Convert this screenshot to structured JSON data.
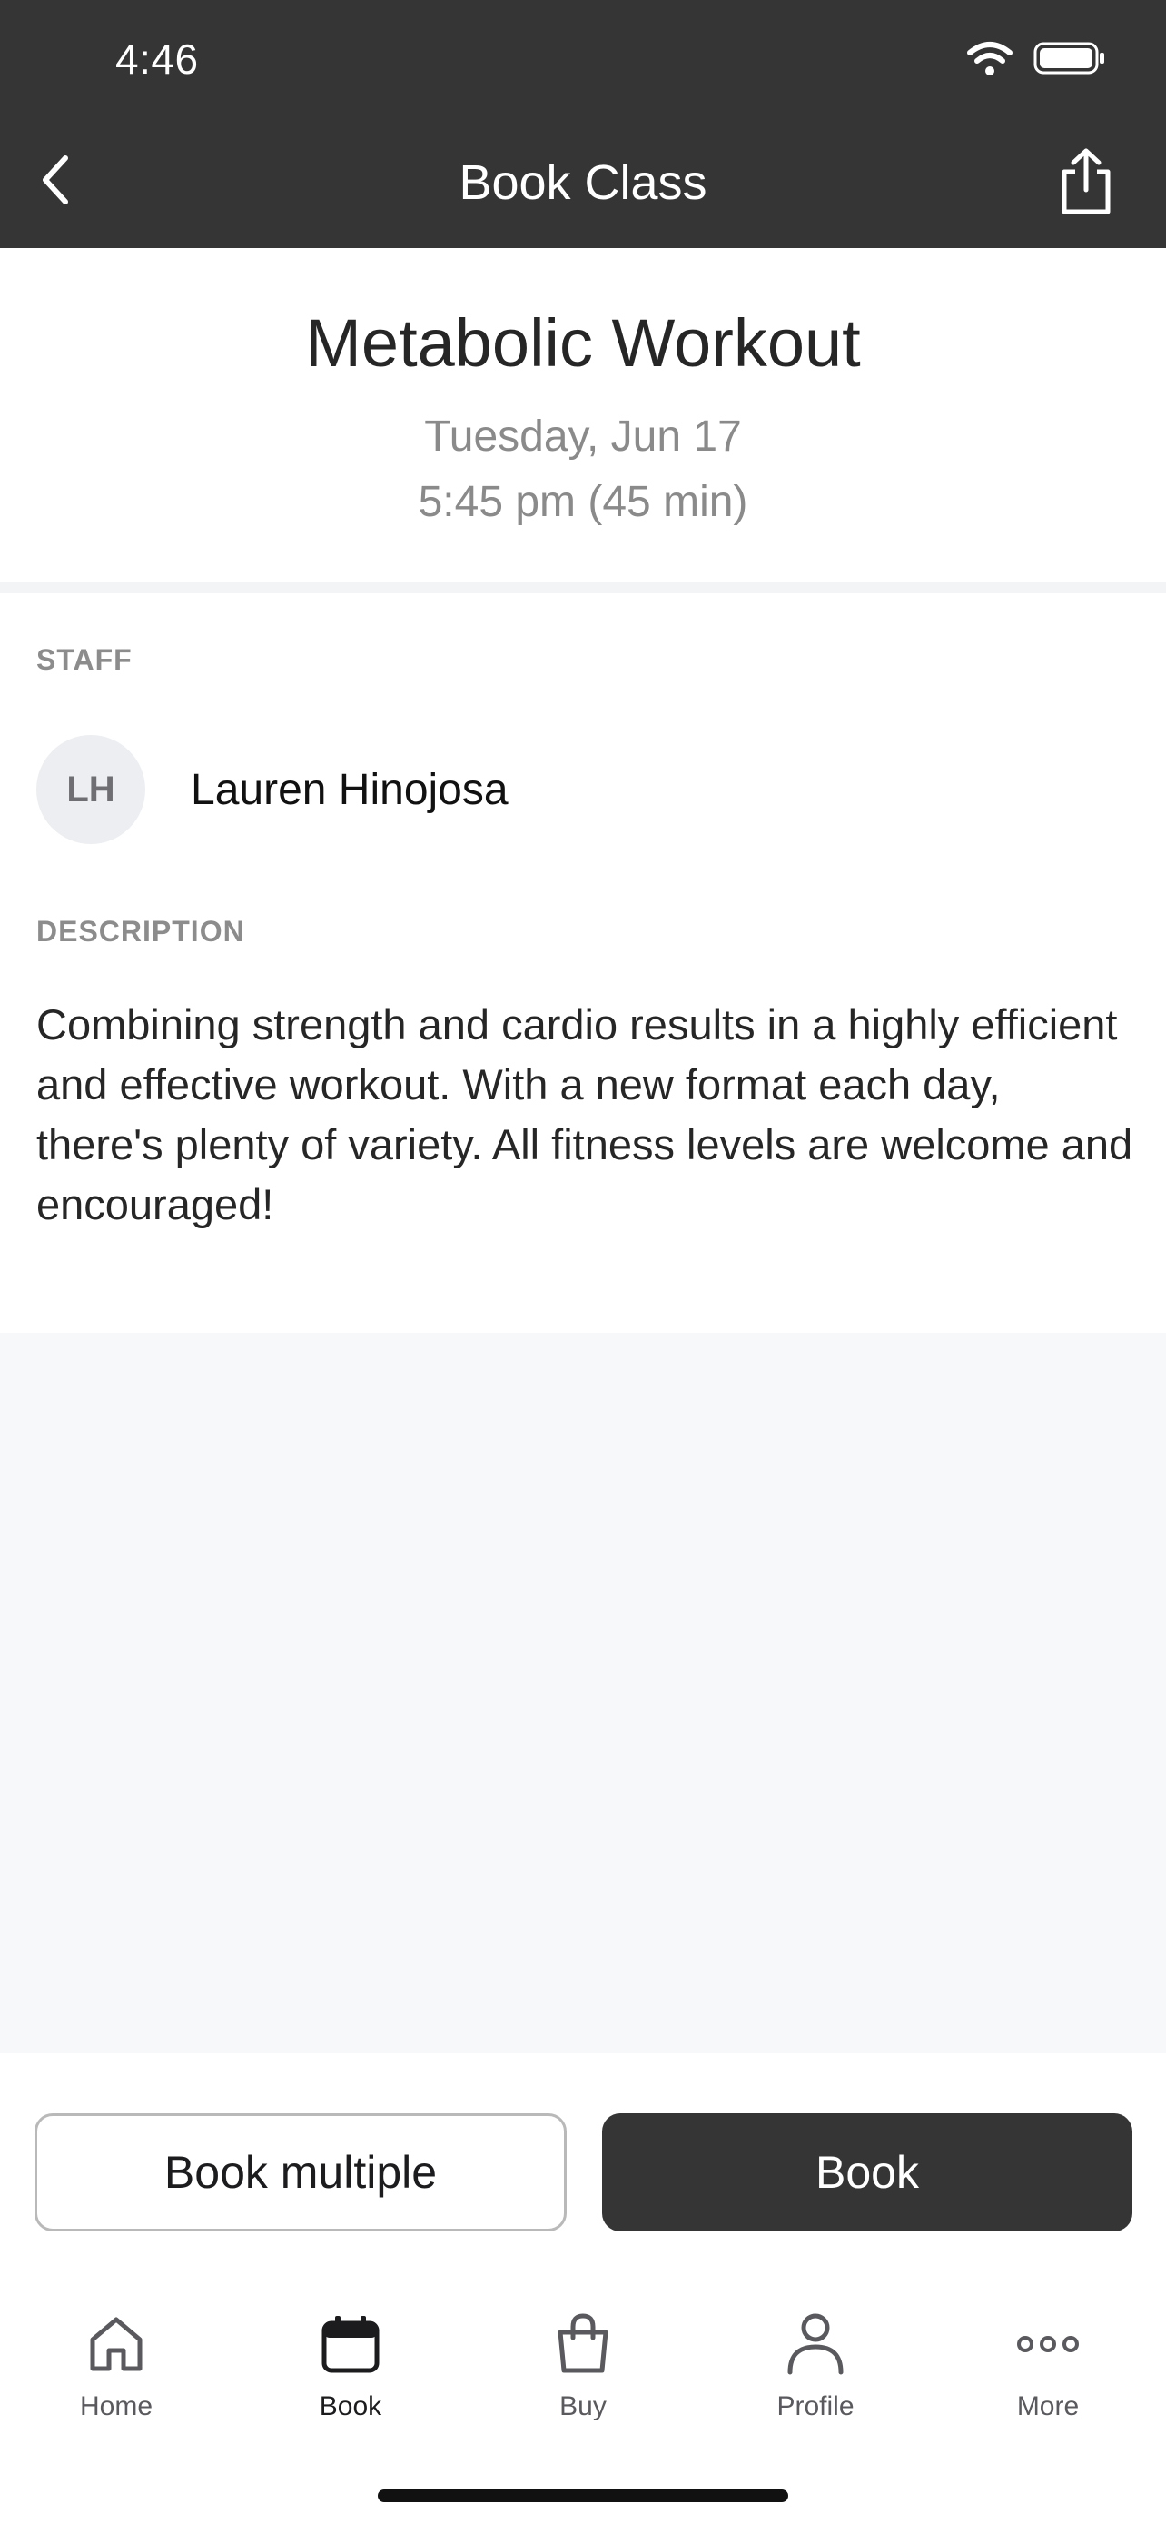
{
  "status_bar": {
    "time": "4:46"
  },
  "nav": {
    "title": "Book Class",
    "back_icon": "chevron-left-icon",
    "share_icon": "share-icon"
  },
  "class": {
    "name": "Metabolic Workout",
    "date": "Tuesday, Jun 17",
    "time": "5:45 pm (45 min)"
  },
  "staff": {
    "label": "STAFF",
    "initials": "LH",
    "name": "Lauren Hinojosa"
  },
  "description": {
    "label": "DESCRIPTION",
    "text": "Combining strength and cardio results in a highly efficient and effective workout. With a new format each day, there's plenty of variety. All fitness levels are welcome and encouraged!"
  },
  "actions": {
    "book_multiple": "Book multiple",
    "book": "Book"
  },
  "tabs": [
    {
      "label": "Home",
      "icon": "home-icon",
      "active": false
    },
    {
      "label": "Book",
      "icon": "calendar-icon",
      "active": true
    },
    {
      "label": "Buy",
      "icon": "bag-icon",
      "active": false
    },
    {
      "label": "Profile",
      "icon": "person-icon",
      "active": false
    },
    {
      "label": "More",
      "icon": "more-icon",
      "active": false
    }
  ],
  "colors": {
    "header_bg": "#353535",
    "primary_button": "#353535",
    "muted_text": "#8a8a8a"
  }
}
